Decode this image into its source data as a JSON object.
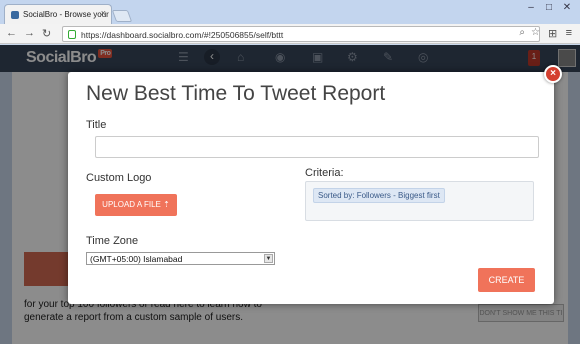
{
  "browser": {
    "tab_title": "SocialBro - Browse your T",
    "url": "https://dashboard.socialbro.com/#!250506855/self/bttt",
    "notification_count": "1"
  },
  "app": {
    "logo_text": "SocialBro",
    "logo_badge": "Pro"
  },
  "background": {
    "text_line1": "for your top 100 followers or read here to learn how to",
    "text_line2": "generate a report from a custom sample of users.",
    "right_button": "DON'T SHOW ME THIS TI"
  },
  "modal": {
    "title": "New Best Time To Tweet Report",
    "title_label": "Title",
    "title_value": "",
    "custom_logo_label": "Custom Logo",
    "upload_button": "UPLOAD A FILE",
    "criteria_label": "Criteria:",
    "criteria_chip": "Sorted by: Followers - Biggest first",
    "timezone_label": "Time Zone",
    "timezone_value": "(GMT+05:00) Islamabad",
    "create_button": "CREATE",
    "close_glyph": "×"
  },
  "colors": {
    "accent": "#f0735a",
    "appbar": "#38465a",
    "close": "#d43f2f"
  }
}
